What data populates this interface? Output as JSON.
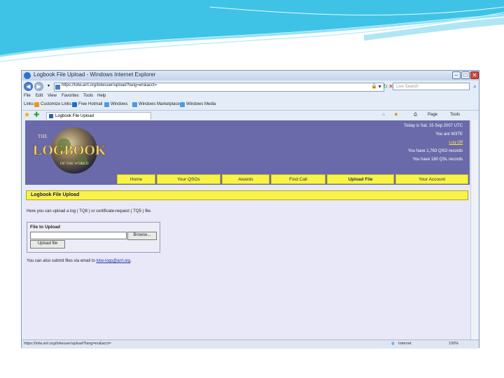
{
  "window": {
    "title": "Logbook File Upload - Windows Internet Explorer",
    "url": "https://lotw.arrl.org/lotwuser/upload?lang=en&acct=",
    "search_placeholder": "Live Search"
  },
  "menu": [
    "File",
    "Edit",
    "View",
    "Favorites",
    "Tools",
    "Help"
  ],
  "links_bar": {
    "label": "Links",
    "items": [
      "Customize Links",
      "Free Hotmail",
      "Windows",
      "Windows Marketplace",
      "Windows Media"
    ]
  },
  "tab": {
    "label": "Logbook File Upload"
  },
  "toolbar": {
    "page_label": "Page",
    "tools_label": "Tools"
  },
  "header": {
    "logo_top": "THE",
    "logo_main": "LOGBOOK",
    "logo_sub": "OF THE WORLD",
    "date_line": "Today is Sat, 15 Sep 2007 UTC",
    "user_line": "You are W3TE",
    "logoff": "Log Off",
    "qso_line": "You have 1,763 QSO records",
    "qsl_line": "You have 180 QSL records"
  },
  "nav": [
    "Home",
    "Your QSOs",
    "Awards",
    "Find Call",
    "Upload File",
    "Your Account"
  ],
  "section_title": "Logbook File Upload",
  "intro_text": "Here you can upload a log ( TQ8 ) or certificate-request ( TQ5 ) file.",
  "form": {
    "label": "File to Upload",
    "browse_button": "Browse...",
    "upload_button": "Upload file"
  },
  "email_note": {
    "prefix": "You can also submit files via email to",
    "address": "lotw-logs@arrl.org",
    "suffix": "."
  },
  "status_bar": {
    "url": "https://lotw.arrl.org/lotwuser/upload?lang=en&acct=",
    "zone": "Internet",
    "zoom": "100%"
  }
}
